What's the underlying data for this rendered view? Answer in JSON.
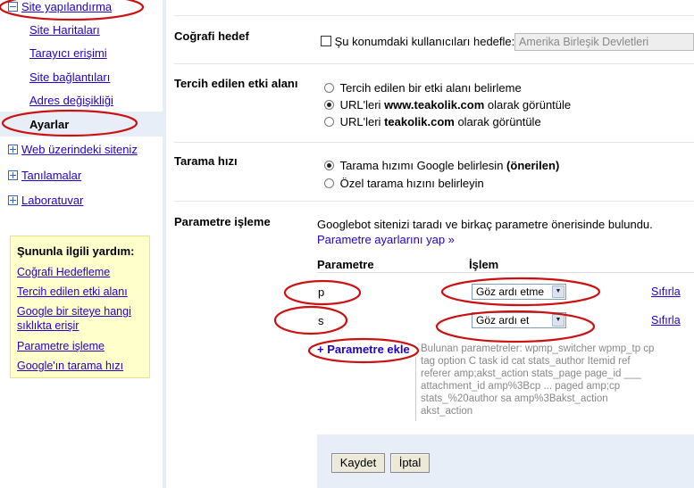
{
  "sidebar": {
    "parent_label": "Site yapılandırma",
    "children": [
      "Site Haritaları",
      "Tarayıcı erişimi",
      "Site bağlantıları",
      "Adres değişikliği",
      "Ayarlar"
    ],
    "sections": [
      "Web üzerindeki siteniz",
      "Tanılamalar",
      "Laboratuvar"
    ]
  },
  "help": {
    "title": "Şununla ilgili yardım:",
    "links": [
      "Coğrafi Hedefleme",
      "Tercih edilen etki alanı",
      "Google bir siteye hangi sıklıkta erişir",
      "Parametre işleme",
      "Google'ın tarama hızı"
    ]
  },
  "settings": {
    "geo": {
      "label": "Coğrafi hedef",
      "checkbox_label": "Şu konumdaki kullanıcıları hedefle:",
      "checked": false,
      "country": "Amerika Birleşik Devletleri"
    },
    "domain": {
      "label": "Tercih edilen etki alanı",
      "options": [
        {
          "pre": "Tercih edilen bir etki alanı belirleme",
          "bold": "",
          "post": "",
          "selected": false
        },
        {
          "pre": "URL'leri ",
          "bold": "www.teakolik.com",
          "post": " olarak görüntüle",
          "selected": true
        },
        {
          "pre": "URL'leri ",
          "bold": "teakolik.com",
          "post": " olarak görüntüle",
          "selected": false
        }
      ]
    },
    "crawl": {
      "label": "Tarama hızı",
      "options": [
        {
          "pre": "Tarama hızımı Google belirlesin ",
          "bold": "(önerilen)",
          "selected": true
        },
        {
          "pre": "Özel tarama hızını belirleyin",
          "bold": "",
          "selected": false
        }
      ]
    },
    "params": {
      "label": "Parametre işleme",
      "desc": "Googlebot sitenizi taradı ve birkaç parametre önerisinde bulundu.",
      "settings_link": "Parametre ayarlarını yap »",
      "col_param": "Parametre",
      "col_action": "İşlem",
      "rows": [
        {
          "param": "p",
          "action": "Göz ardı etme",
          "reset": "Sıfırla"
        },
        {
          "param": "s",
          "action": "Göz ardı et",
          "reset": "Sıfırla"
        }
      ],
      "add_label": "+ Parametre ekle",
      "found_text": "Bulunan parametreler: wpmp_switcher wpmp_tp cp tag option C task id cat stats_author Itemid ref referer amp;akst_action stats_page page_id ___ attachment_id amp%3Bcp ... paged amp;cp stats_%20author sa amp%3Bakst_action akst_action"
    }
  },
  "actions": {
    "save": "Kaydet",
    "cancel": "İptal"
  },
  "colors": {
    "annotation_red": "#cc1111",
    "link": "#2200cc",
    "highlight": "#e8eef7",
    "help_bg": "#ffffcc"
  }
}
